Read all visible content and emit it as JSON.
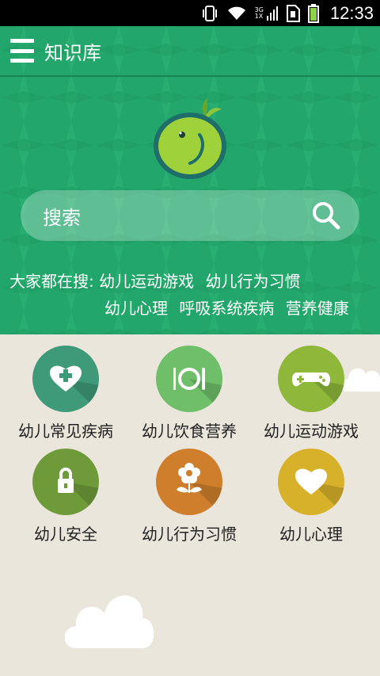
{
  "status_bar": {
    "time": "12:33",
    "network_label_top": "3G",
    "network_label_bottom": "1X",
    "icons": [
      "vibrate-icon",
      "wifi-icon",
      "signal-icon",
      "sim-icon",
      "battery-icon"
    ]
  },
  "app_bar": {
    "title": "知识库"
  },
  "search": {
    "placeholder": "搜索"
  },
  "hot_searches": {
    "label": "大家都在搜:",
    "tags": [
      "幼儿运动游戏",
      "幼儿行为习惯",
      "幼儿心理",
      "呼吸系统疾病",
      "营养健康"
    ]
  },
  "categories": [
    {
      "label": "幼儿常见疾病",
      "icon": "heart-plus-icon",
      "color": "#3f9a7a"
    },
    {
      "label": "幼儿饮食营养",
      "icon": "plate-cutlery-icon",
      "color": "#6fbf6a"
    },
    {
      "label": "幼儿运动游戏",
      "icon": "gamepad-icon",
      "color": "#8fb83b"
    },
    {
      "label": "幼儿安全",
      "icon": "lock-icon",
      "color": "#6f9a3a"
    },
    {
      "label": "幼儿行为习惯",
      "icon": "flower-icon",
      "color": "#cf7f2c"
    },
    {
      "label": "幼儿心理",
      "icon": "heart-icon",
      "color": "#d8b12a"
    }
  ],
  "colors": {
    "hero": "#23a66b",
    "background": "#ebe6dc"
  }
}
